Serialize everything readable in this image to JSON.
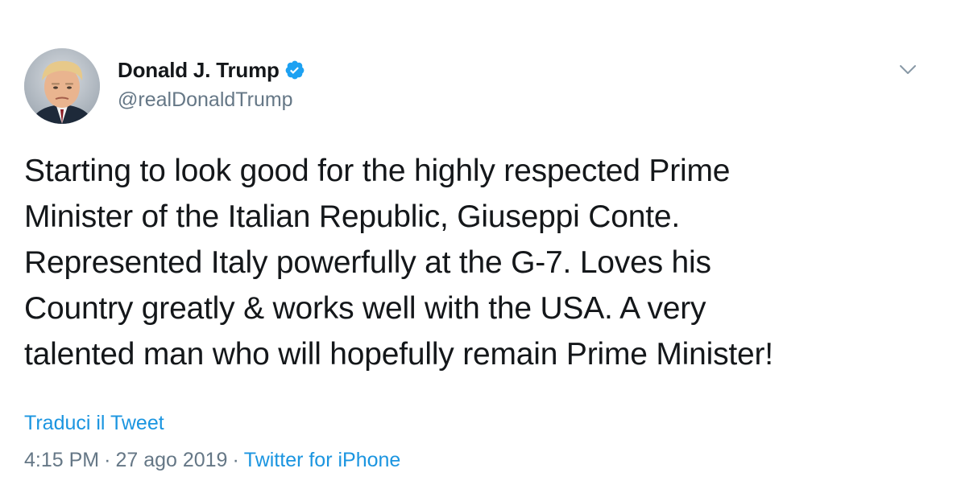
{
  "tweet": {
    "author": {
      "display_name": "Donald J. Trump",
      "handle": "@realDonaldTrump",
      "verified": true,
      "avatar_icon": "profile-photo",
      "verified_icon": "verified-badge-icon",
      "verified_color": "#1da1f2"
    },
    "menu_icon": "chevron-down-icon",
    "text_lines": [
      "Starting to look good for the highly respected Prime",
      "Minister of the Italian Republic, Giuseppi Conte.",
      "Represented Italy powerfully at the G-7. Loves his",
      "Country greatly & works well with the USA. A very",
      "talented man who will hopefully remain Prime Minister!"
    ],
    "translate_label": "Traduci il Tweet",
    "timestamp": {
      "time": "4:15 PM",
      "separator": "·",
      "date": "27 ago 2019",
      "source": "Twitter for iPhone"
    }
  },
  "colors": {
    "text": "#14171a",
    "secondary": "#657786",
    "link": "#1b95e0"
  }
}
